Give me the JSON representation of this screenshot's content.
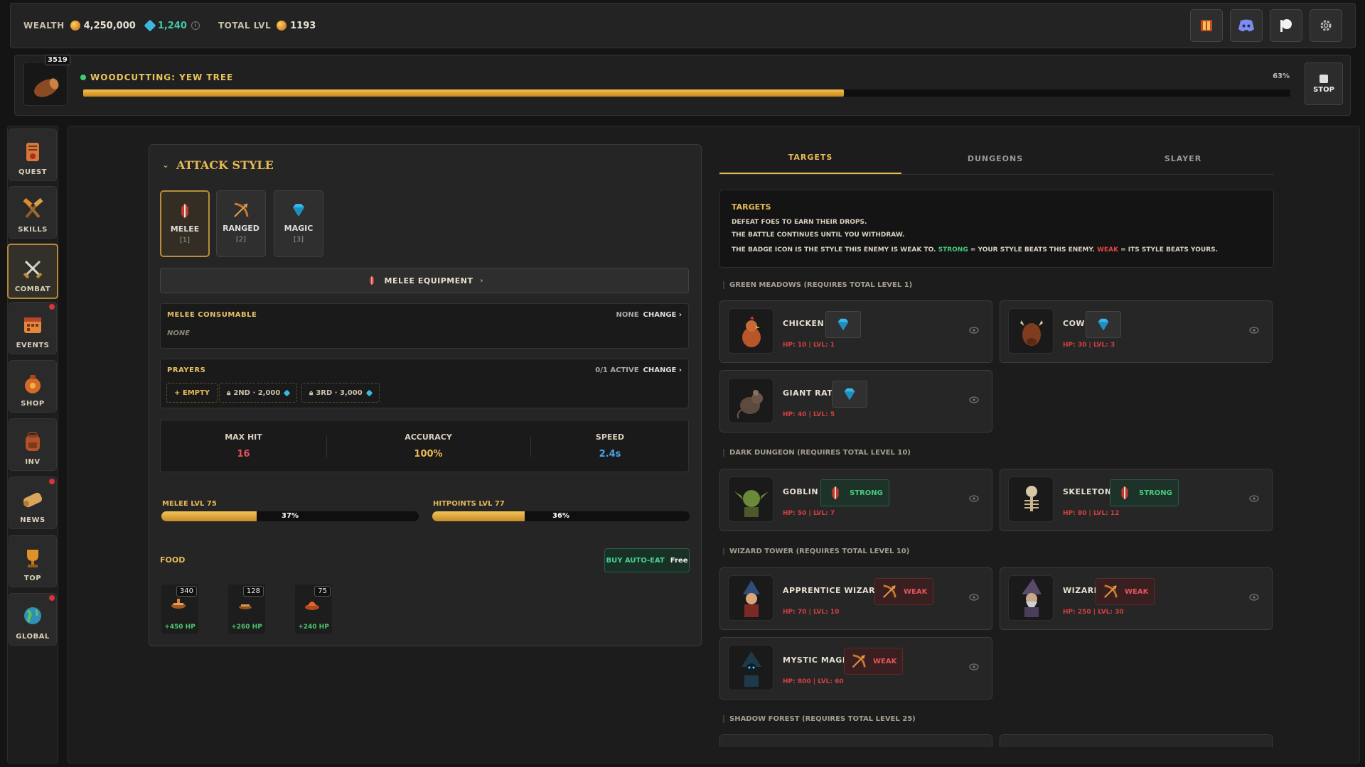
{
  "topbar": {
    "wealth_label": "WEALTH",
    "gold": "4,250,000",
    "gems": "1,240",
    "total_level_label": "TOTAL LVL",
    "total_level": "1193",
    "buttons": [
      "book-icon",
      "discord-icon",
      "patreon-icon",
      "gear-icon"
    ]
  },
  "action": {
    "count": "3519",
    "title": "WOODCUTTING: YEW TREE",
    "progress_pct": "63%",
    "progress": 0.63,
    "stop_label": "STOP"
  },
  "sidebar": {
    "items": [
      {
        "label": "QUEST",
        "icon": "scroll-icon",
        "active": false,
        "badge": false
      },
      {
        "label": "SKILLS",
        "icon": "tools-icon",
        "active": false,
        "badge": false
      },
      {
        "label": "COMBAT",
        "icon": "crossed-swords-icon",
        "active": true,
        "badge": false
      },
      {
        "label": "EVENTS",
        "icon": "calendar-icon",
        "active": false,
        "badge": true
      },
      {
        "label": "SHOP",
        "icon": "bag-icon",
        "active": false,
        "badge": false
      },
      {
        "label": "INV",
        "icon": "backpack-icon",
        "active": false,
        "badge": false
      },
      {
        "label": "NEWS",
        "icon": "newspaper-icon",
        "active": false,
        "badge": true
      },
      {
        "label": "TOP",
        "icon": "trophy-icon",
        "active": false,
        "badge": false
      },
      {
        "label": "GLOBAL",
        "icon": "globe-icon",
        "active": false,
        "badge": true
      }
    ]
  },
  "attack": {
    "title": "ATTACK STYLE",
    "styles": [
      {
        "name": "MELEE",
        "key": "[1]",
        "active": true
      },
      {
        "name": "RANGED",
        "key": "[2]",
        "active": false
      },
      {
        "name": "MAGIC",
        "key": "[3]",
        "active": false
      }
    ],
    "equipment_label": "MELEE EQUIPMENT",
    "consumable": {
      "title": "MELEE CONSUMABLE",
      "status": "NONE",
      "change": "CHANGE ›",
      "value": "NONE"
    },
    "prayers": {
      "title": "PRAYERS",
      "status": "0/1 ACTIVE",
      "change": "CHANGE ›",
      "slots": [
        "+ EMPTY",
        "2ND · 2,000",
        "3RD · 3,000"
      ]
    },
    "stats": [
      {
        "name": "MAX HIT",
        "value": "16",
        "color": "#e2505a"
      },
      {
        "name": "ACCURACY",
        "value": "100%",
        "color": "#e6b957"
      },
      {
        "name": "SPEED",
        "value": "2.4s",
        "color": "#4aa3e6"
      }
    ],
    "skills": [
      {
        "label": "MELEE LVL 75",
        "pct": "37%",
        "fraction": 0.37
      },
      {
        "label": "HITPOINTS LVL 77",
        "pct": "36%",
        "fraction": 0.36
      }
    ],
    "food_label": "FOOD",
    "autoeat": {
      "label": "BUY AUTO-EAT",
      "price": "Free"
    },
    "food": [
      {
        "count": "340",
        "heal": "+450 HP"
      },
      {
        "count": "128",
        "heal": "+260 HP"
      },
      {
        "count": "75",
        "heal": "+240 HP"
      }
    ]
  },
  "tabs": [
    "TARGETS",
    "DUNGEONS",
    "SLAYER"
  ],
  "info": {
    "title": "TARGETS",
    "line1": "DEFEAT FOES TO EARN THEIR DROPS.",
    "line2": "THE BATTLE CONTINUES UNTIL YOU WITHDRAW.",
    "line3_a": "THE BADGE ICON IS THE STYLE THIS ENEMY IS WEAK TO. ",
    "line3_strong": "STRONG",
    "line3_b": " = YOUR STYLE BEATS THIS ENEMY. ",
    "line3_weak": "WEAK",
    "line3_c": " = ITS STYLE BEATS YOURS."
  },
  "zones": [
    "GREEN MEADOWS (REQUIRES TOTAL LEVEL 1)",
    "DARK DUNGEON (REQUIRES TOTAL LEVEL 10)",
    "WIZARD TOWER (REQUIRES TOTAL LEVEL 10)",
    "SHADOW FOREST (REQUIRES TOTAL LEVEL 25)"
  ],
  "enemies": [
    {
      "name": "CHICKEN",
      "stats": "HP: 10 | LVL: 1",
      "weakness": "magic",
      "badge": ""
    },
    {
      "name": "COW",
      "stats": "HP: 30 | LVL: 3",
      "weakness": "magic",
      "badge": ""
    },
    {
      "name": "GIANT RAT",
      "stats": "HP: 40 | LVL: 5",
      "weakness": "magic",
      "badge": ""
    },
    {
      "name": "GOBLIN",
      "stats": "HP: 50 | LVL: 7",
      "weakness": "melee",
      "badge": "STRONG"
    },
    {
      "name": "SKELETON",
      "stats": "HP: 80 | LVL: 12",
      "weakness": "melee",
      "badge": "STRONG"
    },
    {
      "name": "APPRENTICE WIZARD",
      "stats": "HP: 70 | LVL: 10",
      "weakness": "ranged",
      "badge": "WEAK"
    },
    {
      "name": "WIZARD",
      "stats": "HP: 250 | LVL: 30",
      "weakness": "ranged",
      "badge": "WEAK"
    },
    {
      "name": "MYSTIC MAGE",
      "stats": "HP: 800 | LVL: 60",
      "weakness": "ranged",
      "badge": "WEAK"
    }
  ]
}
